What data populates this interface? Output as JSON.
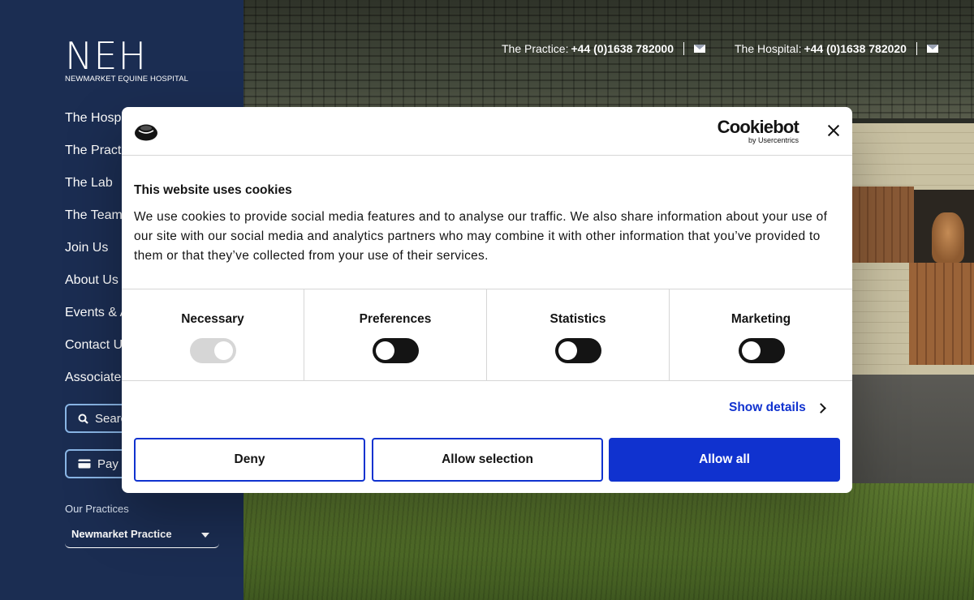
{
  "logo": {
    "mark": "NEH",
    "subtitle": "NEWMARKET EQUINE HOSPITAL"
  },
  "nav": {
    "items": [
      {
        "label": "The Hospi"
      },
      {
        "label": "The Practi"
      },
      {
        "label": "The Lab"
      },
      {
        "label": "The Team"
      },
      {
        "label": "Join Us"
      },
      {
        "label": "About Us"
      },
      {
        "label": "Events & A"
      },
      {
        "label": "Contact U"
      },
      {
        "label": "Associate"
      }
    ]
  },
  "sidebar_buttons": {
    "search_label": "Searc",
    "pay_label": "Pay a"
  },
  "practices": {
    "heading": "Our Practices",
    "selected": "Newmarket Practice"
  },
  "topbar": {
    "practice_label": "The Practice:",
    "practice_phone": "+44 (0)1638 782000",
    "hospital_label": "The Hospital:",
    "hospital_phone": "+44 (0)1638 782020"
  },
  "cookie_dialog": {
    "brand": "Cookiebot",
    "brand_sub": "by Usercentrics",
    "title": "This website uses cookies",
    "body": "We use cookies to provide social media features and to analyse our traffic. We also share information about your use of our site with our social media and analytics partners who may combine it with other information that you’ve provided to them or that they’ve collected from your use of their services.",
    "categories": [
      {
        "label": "Necessary",
        "state": "on-disabled"
      },
      {
        "label": "Preferences",
        "state": "off"
      },
      {
        "label": "Statistics",
        "state": "off"
      },
      {
        "label": "Marketing",
        "state": "off"
      }
    ],
    "show_details": "Show details",
    "buttons": {
      "deny": "Deny",
      "allow_selection": "Allow selection",
      "allow_all": "Allow all"
    },
    "colors": {
      "accent": "#1032cf",
      "text": "#141414",
      "divider": "#d6d6d6"
    }
  },
  "colors": {
    "sidebar": "#1b2d52",
    "button_border": "#8ab6e6"
  }
}
